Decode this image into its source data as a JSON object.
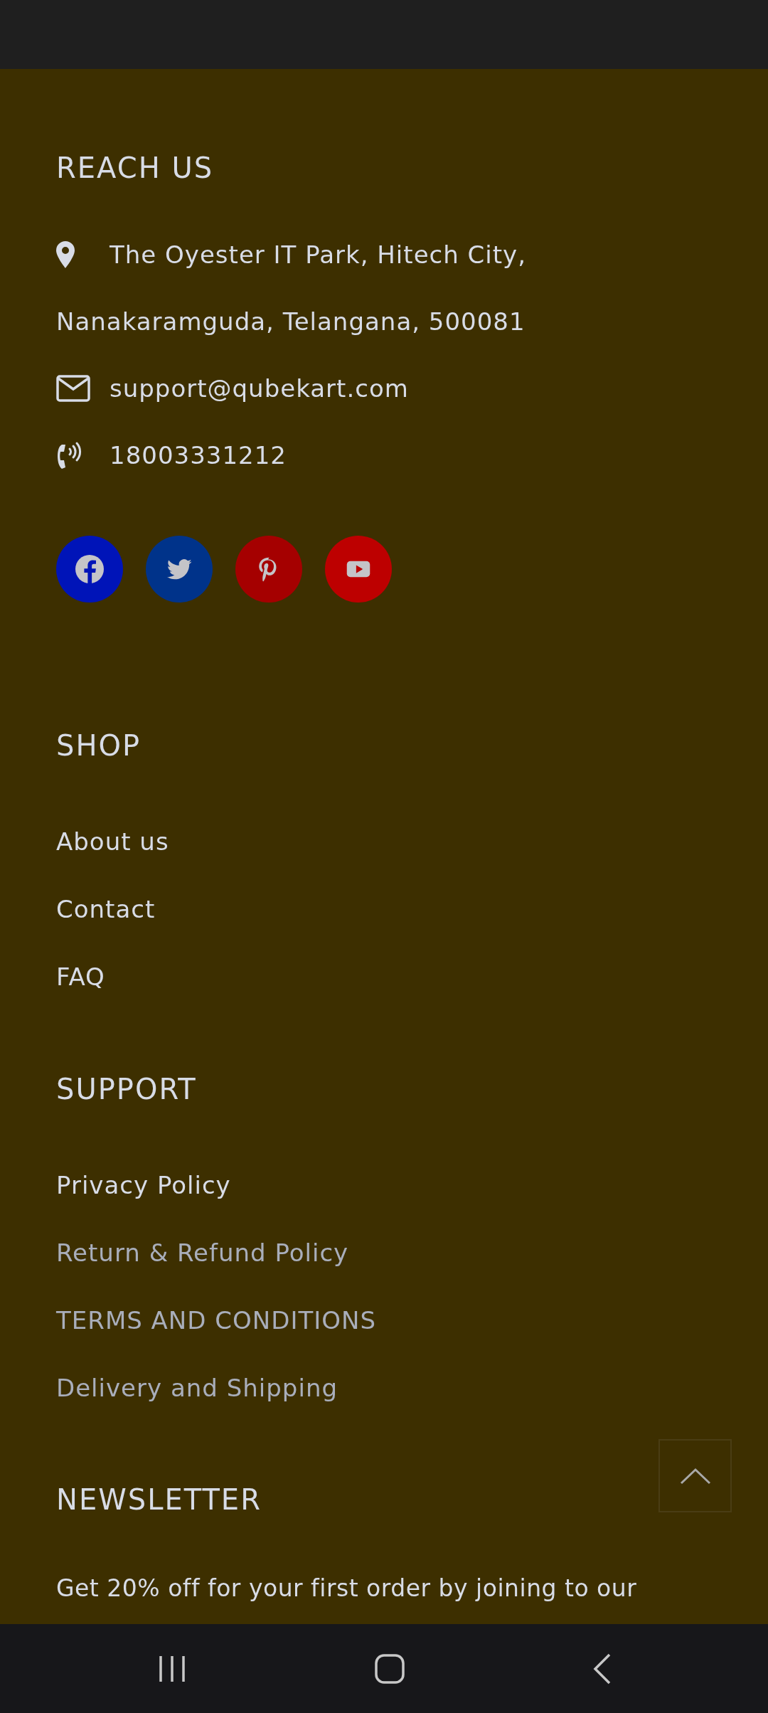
{
  "reach_us": {
    "heading": "REACH US",
    "address_lines": [
      "The Oyester IT Park, Hitech City,",
      "Nanakaramguda, Telangana, 500081"
    ],
    "email": "support@qubekart.com",
    "phone": "18003331212",
    "social": [
      {
        "kind": "facebook",
        "color": "#0014b8"
      },
      {
        "kind": "twitter",
        "color": "#00338a"
      },
      {
        "kind": "pinterest",
        "color": "#a50000"
      },
      {
        "kind": "youtube",
        "color": "#bd0000"
      }
    ]
  },
  "shop": {
    "heading": "SHOP",
    "links": [
      {
        "label": "About us",
        "color": "#d8dce6"
      },
      {
        "label": "Contact",
        "color": "#d8dce6"
      },
      {
        "label": "FAQ",
        "color": "#d8dce6"
      }
    ]
  },
  "support": {
    "heading": "SUPPORT",
    "links": [
      {
        "label": "Privacy Policy",
        "color": "#d8dce6"
      },
      {
        "label": "Return & Refund Policy",
        "color": "#a9aebb"
      },
      {
        "label": "TERMS AND CONDITIONS",
        "color": "#a9aebb"
      },
      {
        "label": "Delivery and Shipping",
        "color": "#a9aebb"
      }
    ]
  },
  "newsletter": {
    "heading": "NEWSLETTER",
    "text": "Get 20% off for your first order by joining to our"
  }
}
